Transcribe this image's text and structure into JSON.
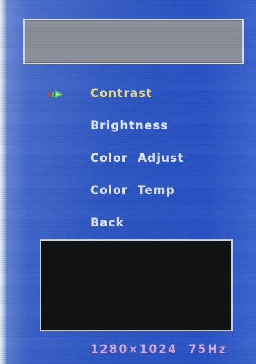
{
  "osd": {
    "menu_items": [
      {
        "label": "Contrast",
        "selected": true
      },
      {
        "label": "Brightness",
        "selected": false
      },
      {
        "label": "Color  Adjust",
        "selected": false
      },
      {
        "label": "Color  Temp",
        "selected": false
      },
      {
        "label": "Back",
        "selected": false
      }
    ],
    "status": "1280×1024  75Hz",
    "colors": {
      "background": "#2f58c4",
      "selected_text": "#e6e08a",
      "text": "#dfe6f6",
      "status_text": "#d7a9d8",
      "title_box": "#8a8f99",
      "preview_box": "#111214"
    },
    "icons": {
      "cursor": "selection-arrow-icon"
    }
  }
}
